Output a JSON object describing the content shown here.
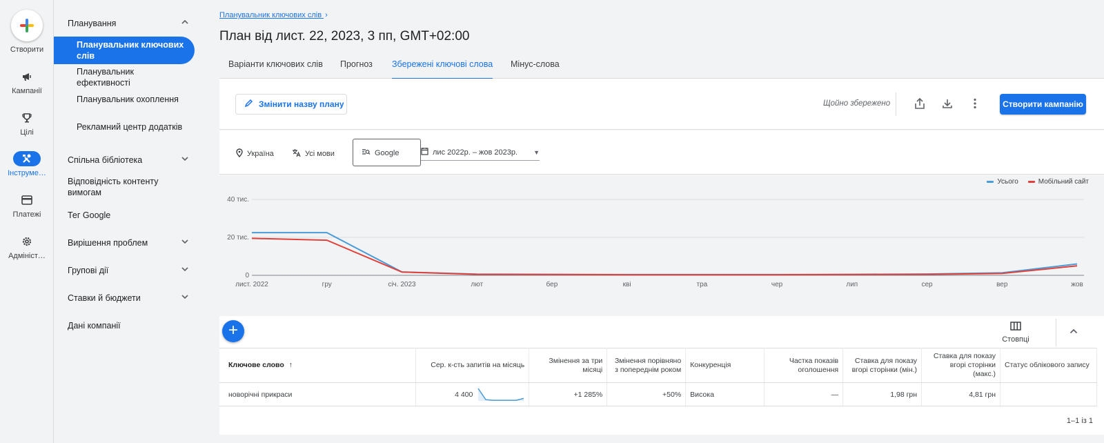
{
  "rail": {
    "create": "Створити",
    "items": [
      {
        "label": "Кампанії",
        "icon": "megaphone-icon"
      },
      {
        "label": "Цілі",
        "icon": "trophy-icon"
      },
      {
        "label": "Інструме…",
        "icon": "tools-icon",
        "active": true
      },
      {
        "label": "Платежі",
        "icon": "credit-card-icon"
      },
      {
        "label": "Адмініст…",
        "icon": "gear-icon"
      }
    ]
  },
  "subnav": {
    "planning": "Планування",
    "keyword_planner": "Планувальник ключових слів",
    "performance_planner": "Планувальник ефективності",
    "reach_planner": "Планувальник охоплення",
    "app_advertising_hub": "Рекламний центр додатків",
    "shared_library": "Спільна бібліотека",
    "content_suitability": "Відповідність контенту вимогам",
    "google_tag": "Тег Google",
    "troubleshooting": "Вирішення проблем",
    "bulk_actions": "Групові дії",
    "bids_budgets": "Ставки й бюджети",
    "business_data": "Дані компанії"
  },
  "breadcrumb": "Планувальник ключових слів",
  "page_title": "План від лист. 22, 2023, 3 пп, GMT+02:00",
  "tabs": [
    "Варіанти ключових слів",
    "Прогноз",
    "Збережені ключові слова",
    "Мінус-слова"
  ],
  "active_tab": 2,
  "toolbar": {
    "rename": "Змінити назву плану",
    "saved": "Щойно збережено",
    "create_campaign": "Створити кампанію"
  },
  "filters": {
    "location": "Україна",
    "language": "Усі мови",
    "network": "Google",
    "date_range": "лис 2022р. – жов 2023р."
  },
  "colors": {
    "accent": "#1a73e8",
    "total": "#4a9bd6",
    "mobile": "#e0413a"
  },
  "chart_data": {
    "type": "line",
    "categories": [
      "лист. 2022",
      "гру",
      "січ. 2023",
      "лют",
      "бер",
      "кві",
      "тра",
      "чер",
      "лип",
      "сер",
      "вер",
      "жов"
    ],
    "series": [
      {
        "name": "Усього",
        "values": [
          22500,
          22500,
          1800,
          600,
          500,
          400,
          400,
          400,
          500,
          700,
          1300,
          6000
        ]
      },
      {
        "name": "Мобільний сайт",
        "values": [
          19500,
          18500,
          1700,
          500,
          400,
          300,
          300,
          300,
          400,
          500,
          1000,
          5000
        ]
      }
    ],
    "ylim": [
      0,
      40000
    ],
    "yticks": [
      0,
      20000,
      40000
    ],
    "ytick_labels": [
      "0",
      "20 тис.",
      "40 тис."
    ],
    "legend": "top-right",
    "grid": true
  },
  "table": {
    "columns_button": "Стовпці",
    "headers": {
      "keyword": "Ключове слово",
      "avg_searches": "Сер. к-сть запитів на місяць",
      "three_month": "Змінення за три місяці",
      "yoy": "Змінення порівняно з попереднім роком",
      "competition": "Конкуренція",
      "impression_share": "Частка показів оголошення",
      "bid_low": "Ставка для показу вгорі сторінки (мін.)",
      "bid_high": "Ставка для показу вгорі сторінки (макс.)",
      "status": "Статус облікового запису"
    },
    "rows": [
      {
        "keyword": "новорічні прикраси",
        "avg_searches": "4 400",
        "trend": [
          1.0,
          0.1,
          0.05,
          0.05,
          0.05,
          0.05,
          0.2
        ],
        "three_month": "+1 285%",
        "yoy": "+50%",
        "competition": "Висока",
        "impression_share": "—",
        "bid_low": "1,98 грн",
        "bid_high": "4,81 грн",
        "status": ""
      }
    ],
    "pagination": "1–1 із 1"
  }
}
